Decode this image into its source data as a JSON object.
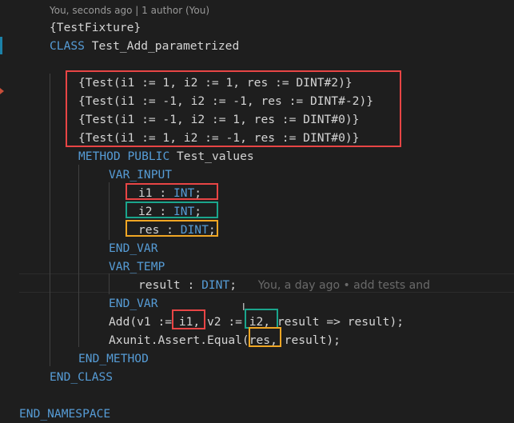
{
  "codelens": "You, seconds ago | 1 author (You)",
  "lines": [
    {
      "tokens": [
        {
          "t": "{TestFixture}",
          "c": "tx"
        }
      ]
    },
    {
      "tokens": [
        {
          "t": "CLASS",
          "c": "kw"
        },
        {
          "t": " Test_Add_parametrized",
          "c": "tx"
        }
      ]
    },
    {
      "tokens": []
    },
    {
      "tokens": [
        {
          "t": "{Test(i1 := 1, i2 := 1, res := DINT#2)}",
          "c": "tx"
        }
      ]
    },
    {
      "tokens": [
        {
          "t": "{Test(i1 := -1, i2 := -1, res := DINT#-2)}",
          "c": "tx"
        }
      ]
    },
    {
      "tokens": [
        {
          "t": "{Test(i1 := -1, i2 := 1, res := DINT#0)}",
          "c": "tx"
        }
      ]
    },
    {
      "tokens": [
        {
          "t": "{Test(i1 := 1, i2 := -1, res := DINT#0)}",
          "c": "tx"
        }
      ]
    },
    {
      "tokens": [
        {
          "t": "METHOD",
          "c": "kw"
        },
        {
          "t": " ",
          "c": "tx"
        },
        {
          "t": "PUBLIC",
          "c": "kw"
        },
        {
          "t": " Test_values",
          "c": "tx"
        }
      ]
    },
    {
      "tokens": [
        {
          "t": "VAR_INPUT",
          "c": "kw"
        }
      ]
    },
    {
      "tokens": [
        {
          "t": "i1 : ",
          "c": "tx"
        },
        {
          "t": "INT",
          "c": "kw"
        },
        {
          "t": ";",
          "c": "tx"
        }
      ]
    },
    {
      "tokens": [
        {
          "t": "i2 : ",
          "c": "tx"
        },
        {
          "t": "INT",
          "c": "kw"
        },
        {
          "t": ";",
          "c": "tx"
        }
      ]
    },
    {
      "tokens": [
        {
          "t": "res : ",
          "c": "tx"
        },
        {
          "t": "DINT",
          "c": "kw"
        },
        {
          "t": ";",
          "c": "tx"
        }
      ]
    },
    {
      "tokens": [
        {
          "t": "END_VAR",
          "c": "kw"
        }
      ]
    },
    {
      "tokens": [
        {
          "t": "VAR_TEMP",
          "c": "kw"
        }
      ]
    },
    {
      "tokens": [
        {
          "t": "result : ",
          "c": "tx"
        },
        {
          "t": "DINT",
          "c": "kw"
        },
        {
          "t": ";",
          "c": "tx"
        }
      ]
    },
    {
      "tokens": [
        {
          "t": "END_VAR",
          "c": "kw"
        }
      ]
    },
    {
      "tokens": [
        {
          "t": "Add(v1 := i1, v2 := i2, result => result);",
          "c": "tx"
        }
      ]
    },
    {
      "tokens": [
        {
          "t": "Axunit.Assert.Equal(res, result);",
          "c": "tx"
        }
      ]
    },
    {
      "tokens": [
        {
          "t": "END_METHOD",
          "c": "kw"
        }
      ]
    },
    {
      "tokens": [
        {
          "t": "END_CLASS",
          "c": "kw"
        }
      ]
    },
    {
      "tokens": []
    },
    {
      "tokens": [
        {
          "t": "END_NAMESPACE",
          "c": "kw"
        }
      ]
    }
  ],
  "blame_annotation": "You, a day ago • add tests and"
}
